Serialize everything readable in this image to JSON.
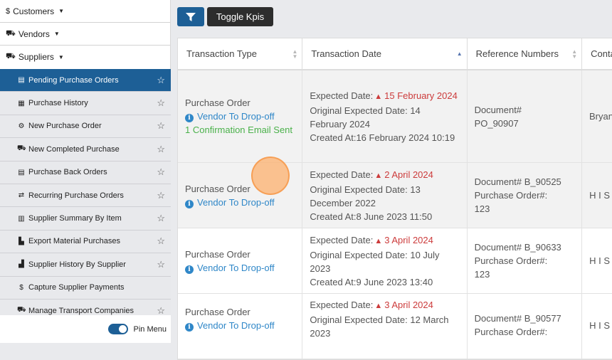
{
  "sidebar": {
    "groups": [
      {
        "icon": "$",
        "label": "Customers"
      },
      {
        "icon": "truck",
        "label": "Vendors"
      },
      {
        "icon": "truck-loading",
        "label": "Suppliers"
      }
    ],
    "items": [
      {
        "icon": "clipboard",
        "label": "Pending Purchase Orders",
        "active": true
      },
      {
        "icon": "table",
        "label": "Purchase History"
      },
      {
        "icon": "dolly",
        "label": "New Purchase Order"
      },
      {
        "icon": "truck-loading",
        "label": "New Completed Purchase"
      },
      {
        "icon": "clipboard",
        "label": "Purchase Back Orders"
      },
      {
        "icon": "recurring",
        "label": "Recurring Purchase Orders"
      },
      {
        "icon": "barcode",
        "label": "Supplier Summary By Item"
      },
      {
        "icon": "file-export",
        "label": "Export Material Purchases"
      },
      {
        "icon": "chart",
        "label": "Supplier History By Supplier"
      },
      {
        "icon": "$",
        "label": "Capture Supplier Payments"
      },
      {
        "icon": "truck",
        "label": "Manage Transport Companies"
      }
    ],
    "pin_menu_label": "Pin Menu"
  },
  "toolbar": {
    "toggle_kpis_label": "Toggle Kpis"
  },
  "table": {
    "headers": [
      "Transaction Type",
      "Transaction Date",
      "Reference Numbers",
      "Conta"
    ],
    "rows": [
      {
        "type": "Purchase Order",
        "vendor_link": "Vendor To Drop-off",
        "confirmation": "1 Confirmation Email Sent",
        "expected_label": "Expected Date:",
        "expected_date": "15 February 2024",
        "original_label": "Original Expected Date:",
        "original_date": "14 February 2024",
        "created_label": "Created At:",
        "created_at": "16 February 2024 10:19",
        "ref_lines": [
          "Document#",
          "PO_90907"
        ],
        "contact": "Bryan"
      },
      {
        "type": "Purchase Order",
        "vendor_link": "Vendor To Drop-off",
        "expected_label": "Expected Date:",
        "expected_date": "2 April 2024",
        "original_label": "Original Expected Date:",
        "original_date": "13 December 2022",
        "created_label": "Created At:",
        "created_at": "8 June 2023 11:50",
        "ref_lines": [
          "Document# B_90525",
          "Purchase Order#:",
          "123"
        ],
        "contact": "H I S"
      },
      {
        "type": "Purchase Order",
        "vendor_link": "Vendor To Drop-off",
        "expected_label": "Expected Date:",
        "expected_date": "3 April 2024",
        "original_label": "Original Expected Date:",
        "original_date": "10 July 2023",
        "created_label": "Created At:",
        "created_at": "9 June 2023 13:40",
        "ref_lines": [
          "Document# B_90633",
          "Purchase Order#:",
          "123"
        ],
        "contact": "H I S"
      },
      {
        "type": "Purchase Order",
        "vendor_link": "Vendor To Drop-off",
        "expected_label": "Expected Date:",
        "expected_date": "3 April 2024",
        "original_label": "Original Expected Date:",
        "original_date": "12 March 2023",
        "ref_lines": [
          "Document# B_90577",
          "Purchase Order#:"
        ],
        "contact": "H I S"
      }
    ]
  },
  "colors": {
    "primary": "#1d5f96",
    "dark_button": "#2d2d2d",
    "link_blue": "#2f87c8",
    "success_green": "#4ab14a",
    "warning_red": "#cc3b3b"
  }
}
